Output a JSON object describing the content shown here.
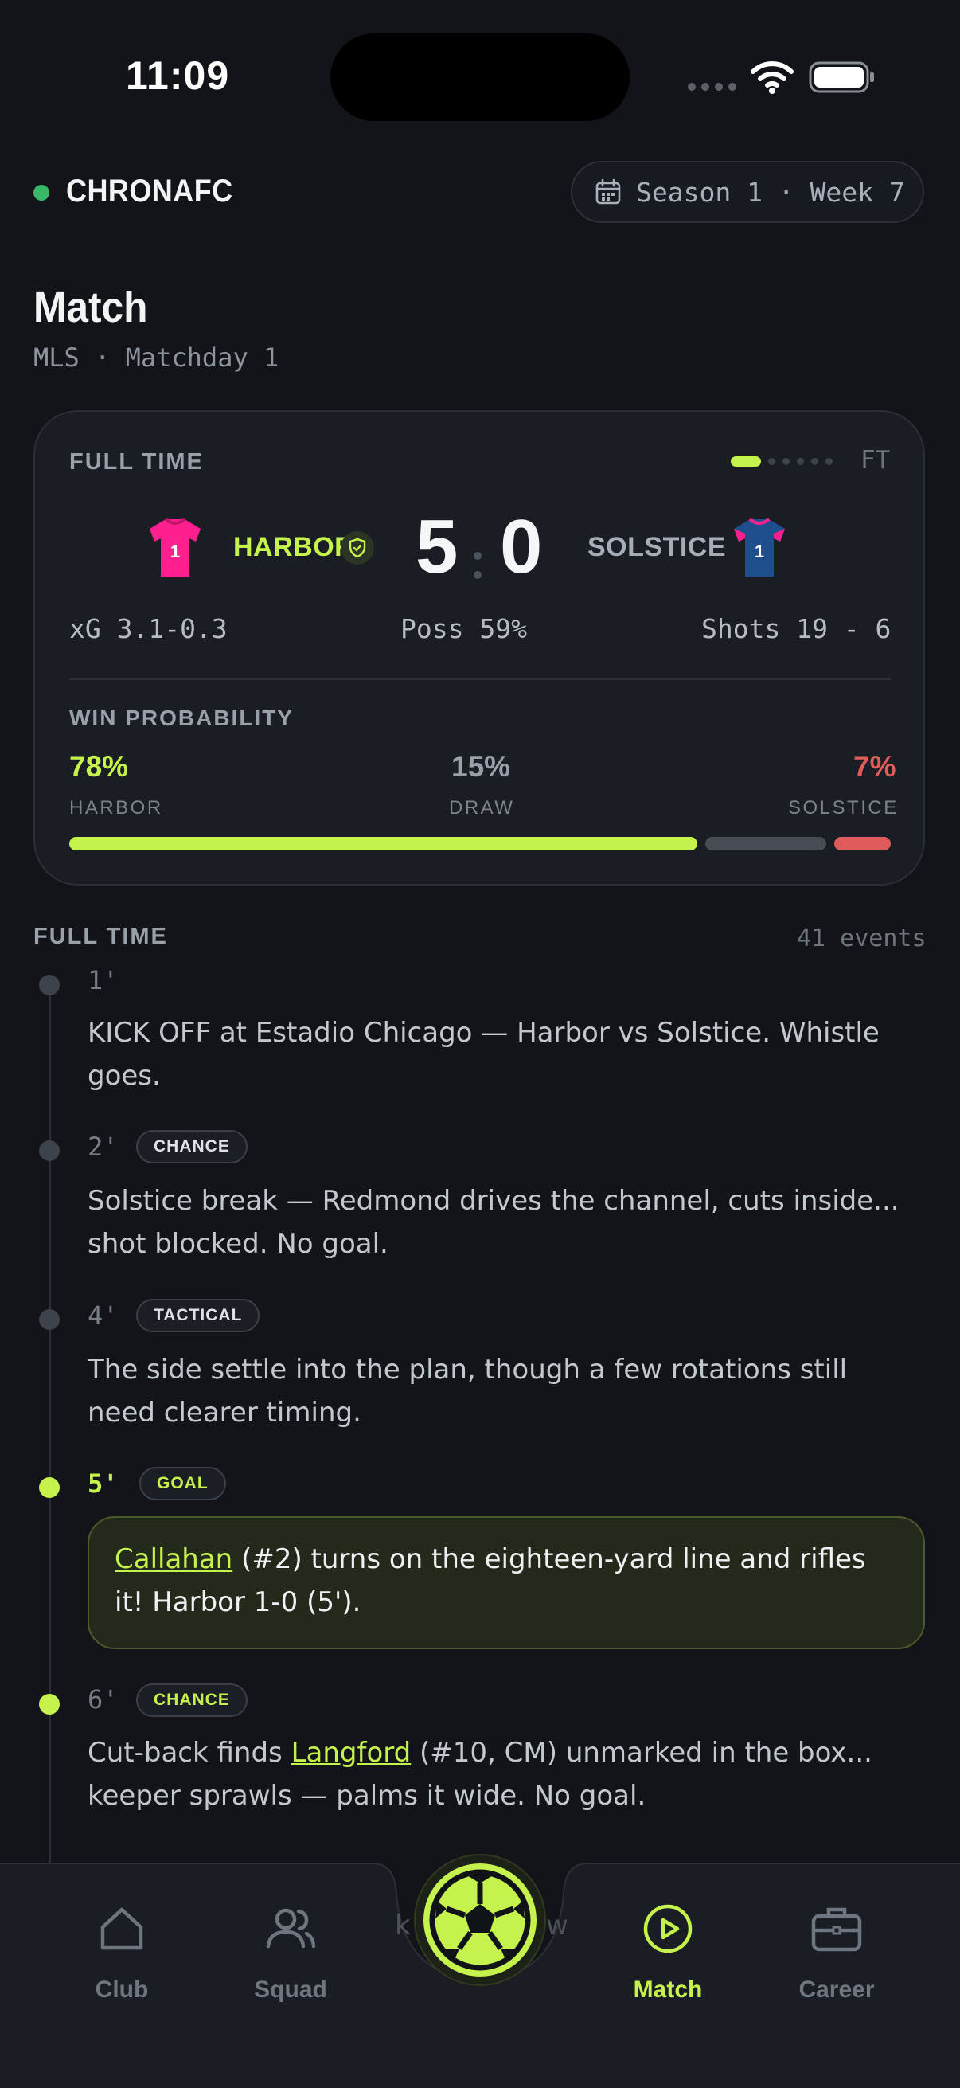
{
  "status_bar": {
    "time": "11:09"
  },
  "header": {
    "brand": "CHRONAFC",
    "season": "Season 1 · Week 7"
  },
  "page": {
    "title": "Match",
    "subtitle": "MLS · Matchday 1"
  },
  "match": {
    "state_label": "FULL TIME",
    "period_tag": "FT",
    "home": {
      "name": "HARBOR",
      "kit_number": "1",
      "kit_color": "#ff1f8e",
      "score": "5"
    },
    "away": {
      "name": "SOLSTICE",
      "kit_number": "1",
      "kit_color": "#1f4e8c",
      "score": "0"
    },
    "stats": {
      "xg": "xG 3.1-0.3",
      "possession": "Poss 59%",
      "shots": "Shots 19 - 6"
    },
    "win_probability": {
      "label": "WIN PROBABILITY",
      "home": {
        "value": "78%",
        "label": "HARBOR",
        "fraction": 0.78
      },
      "draw": {
        "value": "15%",
        "label": "DRAW",
        "fraction": 0.15
      },
      "away": {
        "value": "7%",
        "label": "SOLSTICE",
        "fraction": 0.07
      }
    }
  },
  "feed": {
    "title": "FULL TIME",
    "count": "41 events",
    "events": [
      {
        "minute": "1'",
        "text": "KICK OFF at Estadio Chicago — Harbor vs Solstice. Whistle goes."
      },
      {
        "minute": "2'",
        "tag": "CHANCE",
        "text": "Solstice break — Redmond drives the channel, cuts inside... shot blocked. No goal."
      },
      {
        "minute": "4'",
        "tag": "TACTICAL",
        "text": "The side settle into the plan, though a few rotations still need clearer timing."
      },
      {
        "minute": "5'",
        "tag": "GOAL",
        "player": "Callahan",
        "text": "(#2) turns on the eighteen-yard line and rifles it! Harbor 1-0 (5')."
      },
      {
        "minute": "6'",
        "tag": "CHANCE",
        "text_before": "Cut-back finds",
        "player": "Langford",
        "text": "(#10, CM) unmarked in the box... keeper sprawls — palms it wide. No goal."
      }
    ]
  },
  "nav": {
    "items": [
      {
        "label": "Club",
        "icon": "home-icon"
      },
      {
        "label": "Squad",
        "icon": "users-icon"
      },
      {
        "label": "Match",
        "icon": "play-circle-icon"
      },
      {
        "label": "Career",
        "icon": "briefcase-icon"
      }
    ],
    "center_icon": "soccer-ball-icon"
  },
  "colors": {
    "accent": "#c6f24e",
    "away_prob": "#e05c5c",
    "brand_dot": "#39b86a"
  }
}
